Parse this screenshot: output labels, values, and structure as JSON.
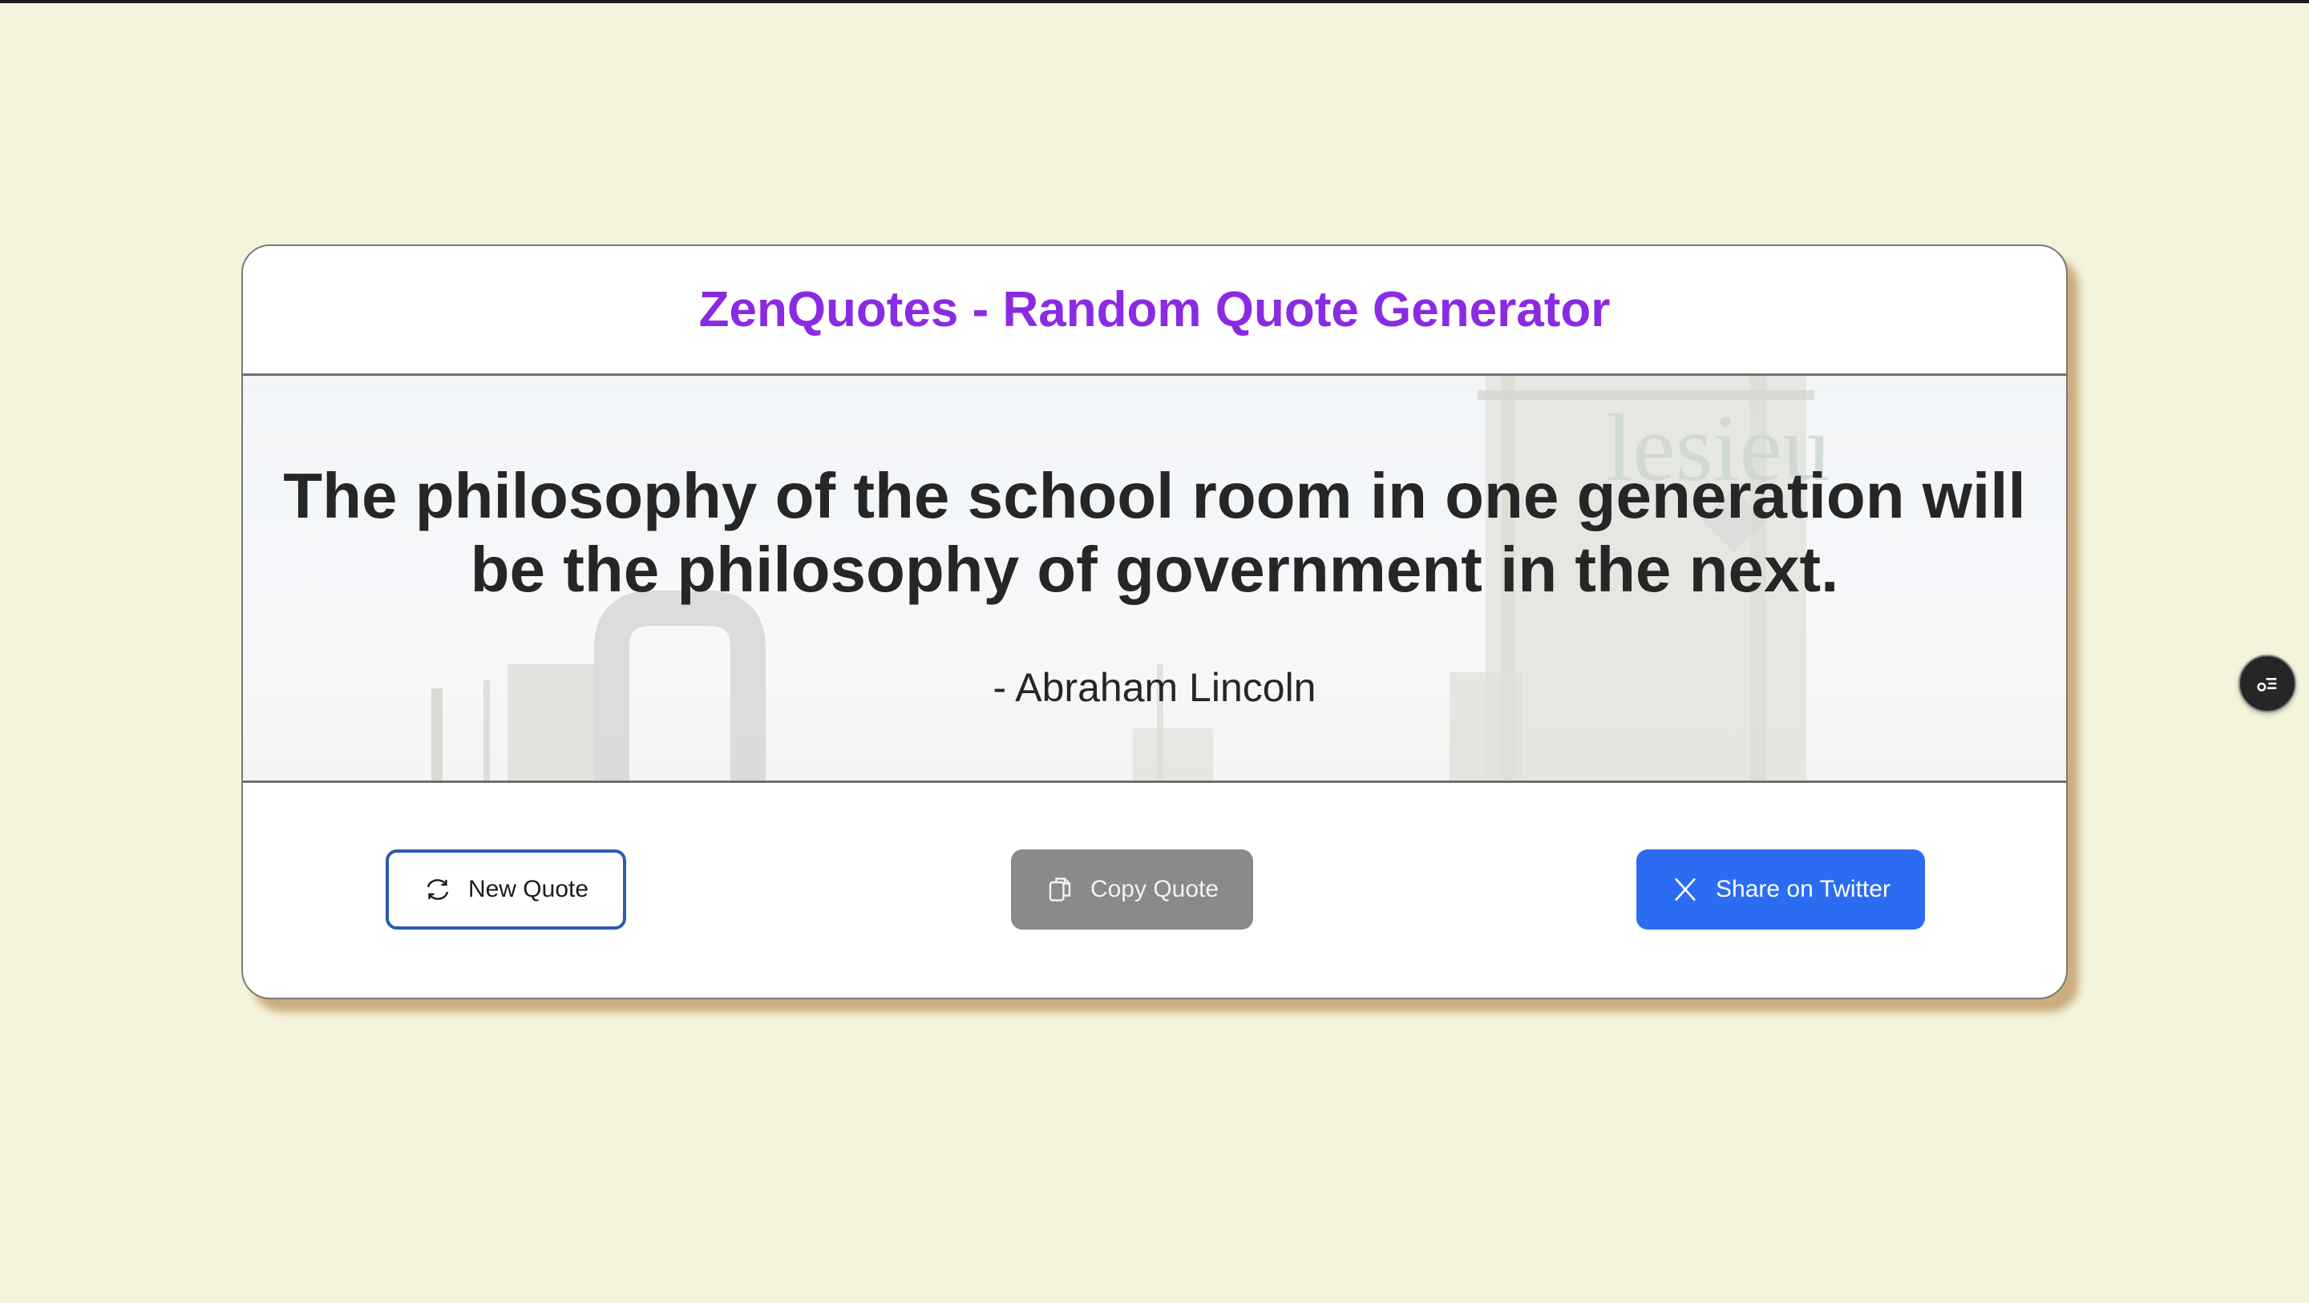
{
  "header": {
    "title": "ZenQuotes - Random Quote Generator"
  },
  "quote": {
    "text": "The philosophy of the school room in one generation will be the philosophy of government in the next.",
    "author": "- Abraham Lincoln",
    "background_sign_text": "lesieu"
  },
  "actions": {
    "new_quote_label": "New Quote",
    "copy_quote_label": "Copy Quote",
    "share_label": "Share on Twitter"
  },
  "icons": {
    "new_quote": "refresh-icon",
    "copy_quote": "copy-icon",
    "share": "x-logo-icon",
    "floating": "list-settings-icon"
  },
  "colors": {
    "page_background": "#f4f4dc",
    "title": "#8a2be2",
    "quote_text": "#262626",
    "new_quote_border": "#2a5db0",
    "copy_button": "#8a8a8a",
    "share_button": "#2b6cf3",
    "card_shadow": "#be965f"
  }
}
